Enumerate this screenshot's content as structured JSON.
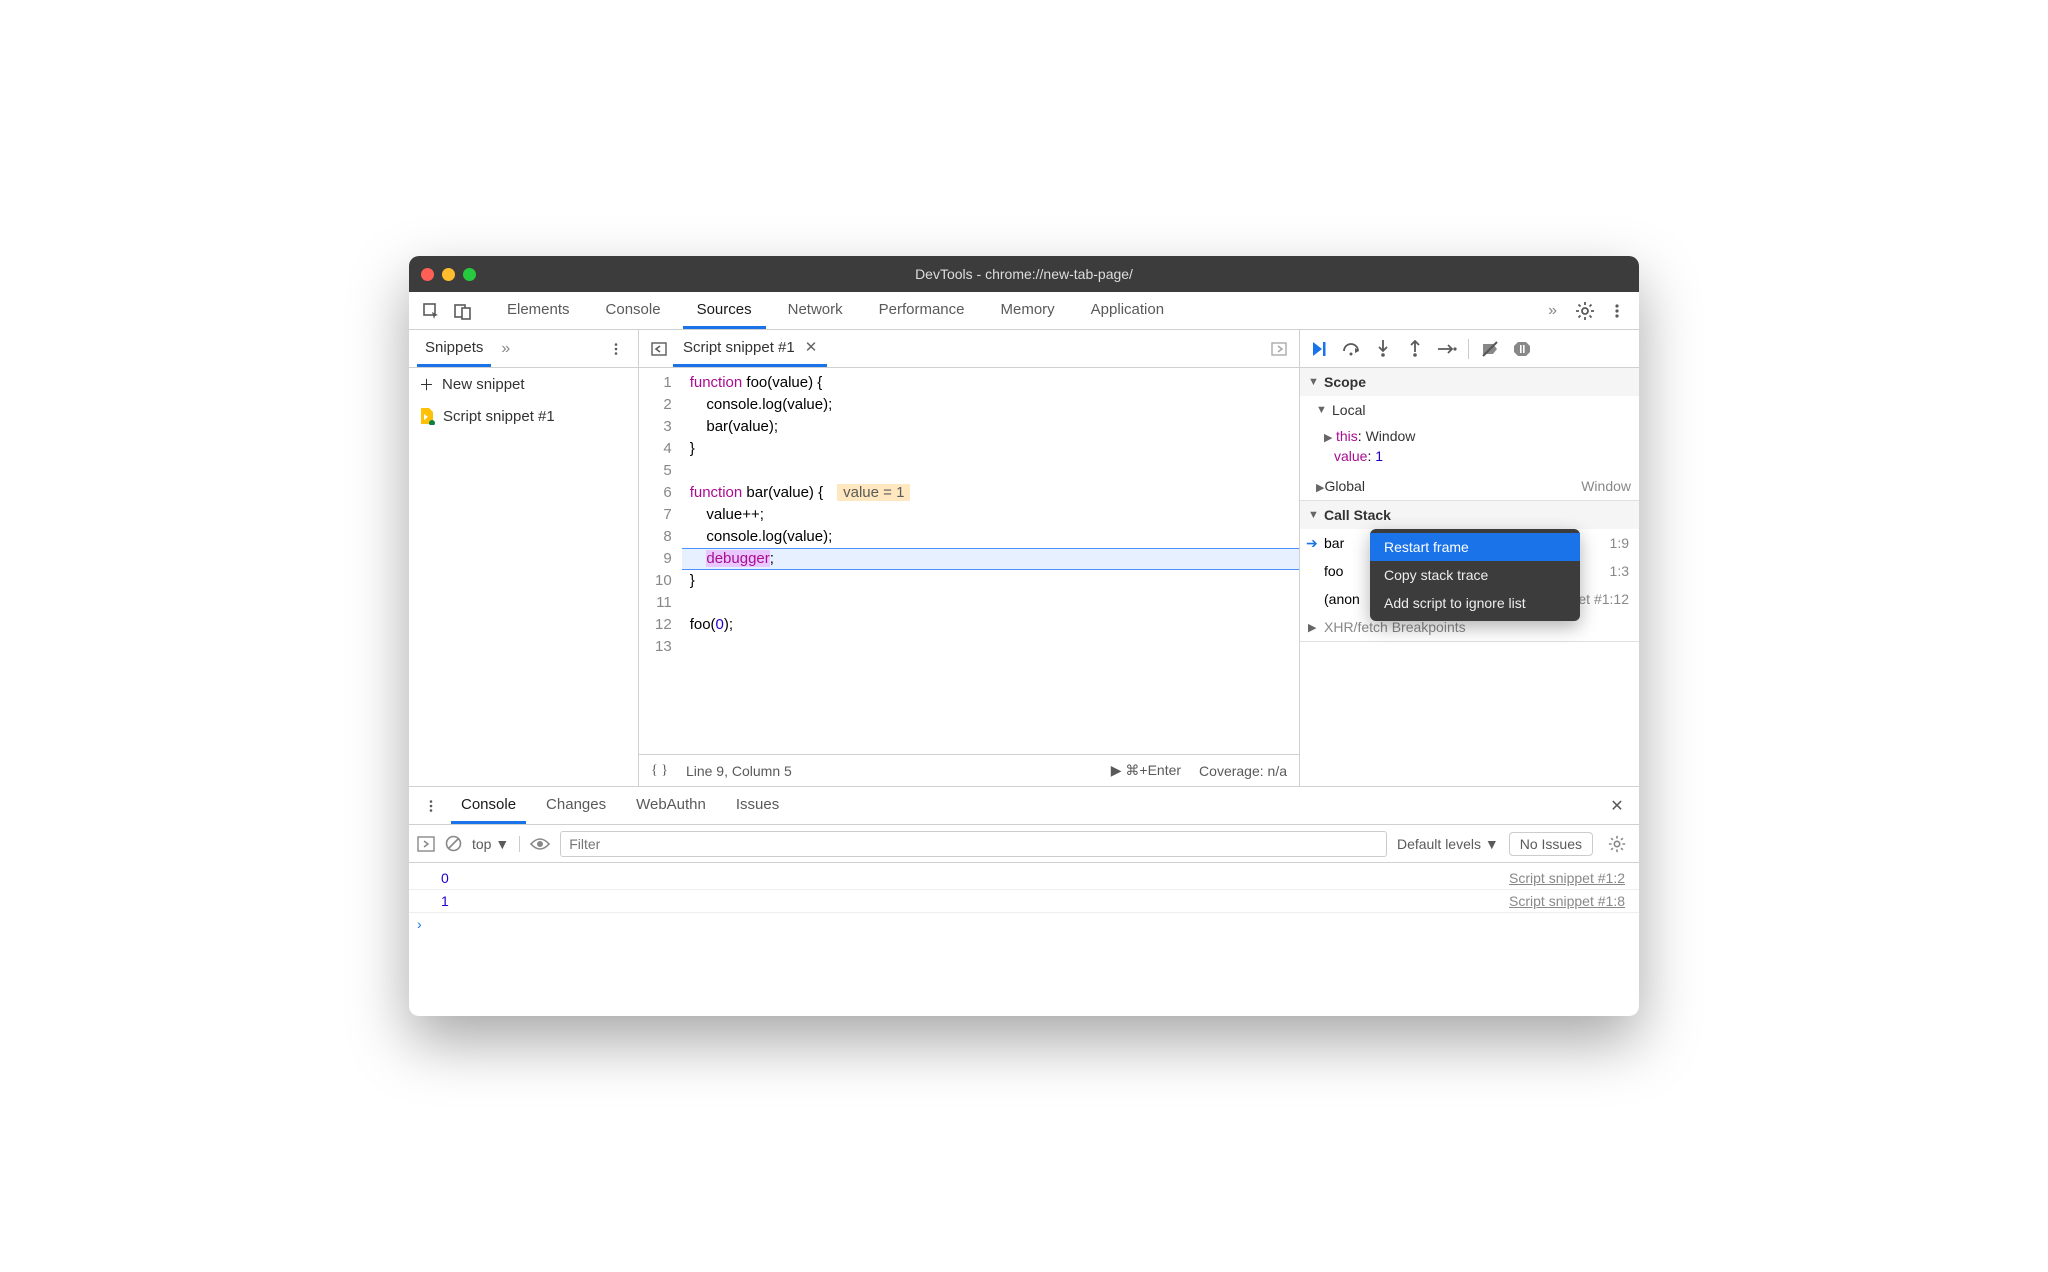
{
  "window": {
    "title": "DevTools - chrome://new-tab-page/"
  },
  "main_tabs": [
    "Elements",
    "Console",
    "Sources",
    "Network",
    "Performance",
    "Memory",
    "Application"
  ],
  "main_active": "Sources",
  "sidebar": {
    "tab": "Snippets",
    "new_label": "New snippet",
    "items": [
      "Script snippet #1"
    ]
  },
  "editor": {
    "tab": "Script snippet #1",
    "lines": [
      {
        "n": 1,
        "html": "<span class='kw'>function</span> foo(value) {"
      },
      {
        "n": 2,
        "html": "    console.log(value);"
      },
      {
        "n": 3,
        "html": "    bar(value);"
      },
      {
        "n": 4,
        "html": "}"
      },
      {
        "n": 5,
        "html": ""
      },
      {
        "n": 6,
        "html": "<span class='kw'>function</span> bar(value) {<span class='inline-val'>value = 1</span>"
      },
      {
        "n": 7,
        "html": "    value++;"
      },
      {
        "n": 8,
        "html": "    console.log(value);"
      },
      {
        "n": 9,
        "html": "    <span class='dbg'>debugger</span>;",
        "hl": true
      },
      {
        "n": 10,
        "html": "}"
      },
      {
        "n": 11,
        "html": ""
      },
      {
        "n": 12,
        "html": "foo(<span class='num'>0</span>);"
      },
      {
        "n": 13,
        "html": ""
      }
    ],
    "status": {
      "pos": "Line 9, Column 5",
      "run": "⌘+Enter",
      "coverage": "Coverage: n/a"
    }
  },
  "scope": {
    "title": "Scope",
    "local": "Local",
    "this_label": "this",
    "this_val": "Window",
    "value_label": "value",
    "value_val": "1",
    "global": "Global",
    "global_val": "Window"
  },
  "callstack": {
    "title": "Call Stack",
    "frames": [
      {
        "fn": "bar",
        "loc": "1:9",
        "current": true
      },
      {
        "fn": "foo",
        "loc": "1:3"
      },
      {
        "fn": "(anon",
        "loc": "Script snippet #1:12"
      }
    ],
    "next_section": "XHR/fetch Breakpoints"
  },
  "context_menu": {
    "items": [
      "Restart frame",
      "Copy stack trace",
      "Add script to ignore list"
    ],
    "selected": 0
  },
  "drawer": {
    "tabs": [
      "Console",
      "Changes",
      "WebAuthn",
      "Issues"
    ],
    "active": "Console",
    "context": "top",
    "filter_placeholder": "Filter",
    "levels": "Default levels",
    "issues_btn": "No Issues",
    "rows": [
      {
        "val": "0",
        "src": "Script snippet #1:2"
      },
      {
        "val": "1",
        "src": "Script snippet #1:8"
      }
    ]
  }
}
